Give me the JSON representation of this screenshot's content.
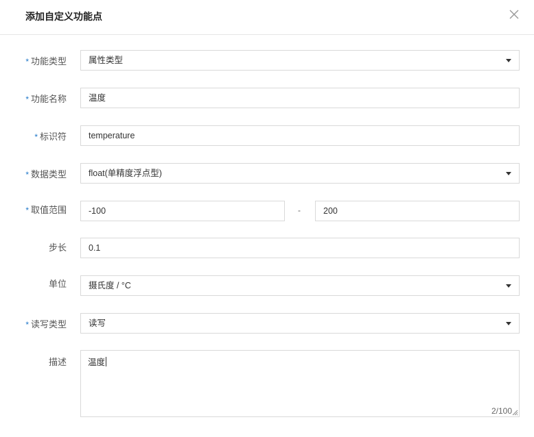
{
  "dialog": {
    "title": "添加自定义功能点"
  },
  "form": {
    "function_type": {
      "label": "功能类型",
      "required": true,
      "value": "属性类型"
    },
    "function_name": {
      "label": "功能名称",
      "required": true,
      "value": "温度"
    },
    "identifier": {
      "label": "标识符",
      "required": true,
      "value": "temperature"
    },
    "data_type": {
      "label": "数据类型",
      "required": true,
      "value": "float(单精度浮点型)"
    },
    "value_range": {
      "label": "取值范围",
      "required": true,
      "min": "-100",
      "separator": "-",
      "max": "200"
    },
    "step": {
      "label": "步长",
      "required": false,
      "value": "0.1"
    },
    "unit": {
      "label": "单位",
      "required": false,
      "value": "摄氏度 / °C"
    },
    "rw_type": {
      "label": "读写类型",
      "required": true,
      "value": "读写"
    },
    "description": {
      "label": "描述",
      "required": false,
      "value": "温度",
      "counter": "2/100"
    }
  },
  "required_mark": "*",
  "colors": {
    "required_star": "#1f77c9",
    "border": "#d9d9d9"
  }
}
